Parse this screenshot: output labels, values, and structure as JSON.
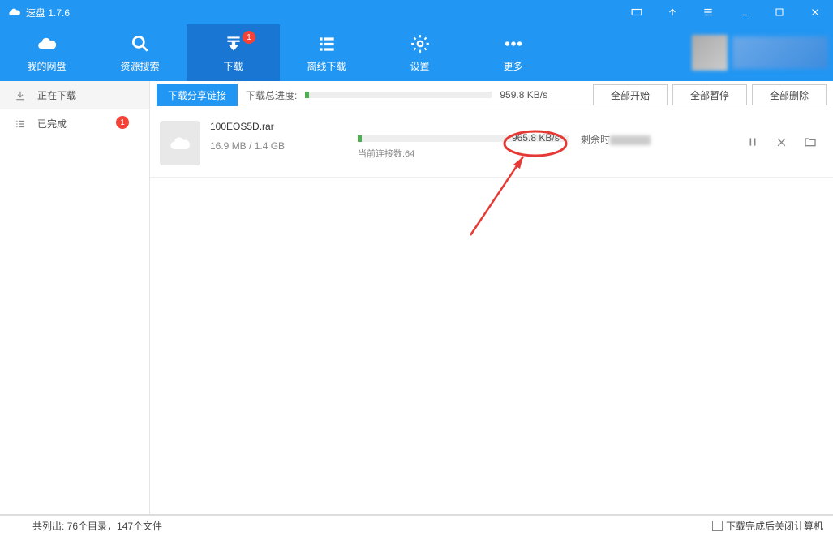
{
  "app": {
    "title": "速盘 1.7.6"
  },
  "nav": {
    "items": [
      {
        "label": "我的网盘"
      },
      {
        "label": "资源搜索"
      },
      {
        "label": "下载",
        "badge": "1"
      },
      {
        "label": "离线下载"
      },
      {
        "label": "设置"
      },
      {
        "label": "更多"
      }
    ]
  },
  "sidebar": {
    "downloading": "正在下载",
    "completed": "已完成",
    "completed_badge": "1"
  },
  "toolbar": {
    "share_btn": "下载分享链接",
    "progress_label": "下载总进度:",
    "total_speed": "959.8 KB/s",
    "start_all": "全部开始",
    "pause_all": "全部暂停",
    "delete_all": "全部删除"
  },
  "download": {
    "filename": "100EOS5D.rar",
    "size": "16.9 MB / 1.4 GB",
    "speed": "965.8 KB/s",
    "remaining_label": "剩余时",
    "connections": "当前连接数:64"
  },
  "statusbar": {
    "summary": "共列出: 76个目录，147个文件",
    "shutdown_label": "下载完成后关闭计算机"
  },
  "chart_data": {
    "type": "bar",
    "title": "Download progress",
    "items": [
      {
        "name": "total_progress",
        "current_mb": 16.9,
        "total_mb": 1433.6,
        "percent": 1.2
      },
      {
        "name": "100EOS5D.rar",
        "current_mb": 16.9,
        "total_mb": 1433.6,
        "percent": 1.2,
        "speed_kbs": 965.8
      }
    ],
    "total_speed_kbs": 959.8
  }
}
